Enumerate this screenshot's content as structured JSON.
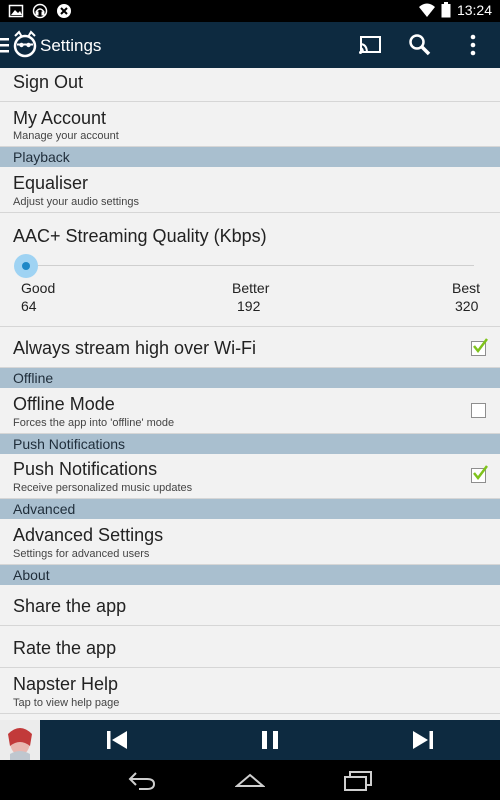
{
  "status": {
    "time": "13:24"
  },
  "app": {
    "title": "Settings"
  },
  "rows": {
    "sign_out": {
      "title": "Sign Out"
    },
    "my_account": {
      "title": "My Account",
      "subtitle": "Manage your account"
    },
    "equaliser": {
      "title": "Equaliser",
      "subtitle": "Adjust your audio settings"
    },
    "quality": {
      "title": "AAC+ Streaming Quality (Kbps)",
      "value_fraction": 0,
      "stops": [
        {
          "label": "Good",
          "value": "64"
        },
        {
          "label": "Better",
          "value": "192"
        },
        {
          "label": "Best",
          "value": "320"
        }
      ]
    },
    "wifi": {
      "title": "Always stream high over Wi-Fi",
      "checked": true
    },
    "offline_mode": {
      "title": "Offline Mode",
      "subtitle": "Forces the app into 'offline' mode",
      "checked": false
    },
    "push": {
      "title": "Push Notifications",
      "subtitle": "Receive personalized music updates",
      "checked": true
    },
    "advanced": {
      "title": "Advanced Settings",
      "subtitle": "Settings for advanced users"
    },
    "share": {
      "title": "Share the app"
    },
    "rate": {
      "title": "Rate the app"
    },
    "help": {
      "title": "Napster Help",
      "subtitle": "Tap to view help page"
    }
  },
  "sections": {
    "playback": "Playback",
    "offline": "Offline",
    "push": "Push Notifications",
    "advanced": "Advanced",
    "about": "About"
  },
  "colors": {
    "appbar": "#0d2a40",
    "section_bg": "#a9bfcf",
    "accent": "#1e88c7",
    "check": "#7fc31c"
  },
  "icons": [
    "image-icon",
    "headset-icon",
    "close-circle-icon",
    "wifi-icon",
    "battery-icon",
    "menu-icon",
    "napster-logo-icon",
    "cast-icon",
    "search-icon",
    "more-vert-icon",
    "previous-icon",
    "pause-icon",
    "next-icon",
    "back-icon",
    "home-icon",
    "recents-icon"
  ]
}
